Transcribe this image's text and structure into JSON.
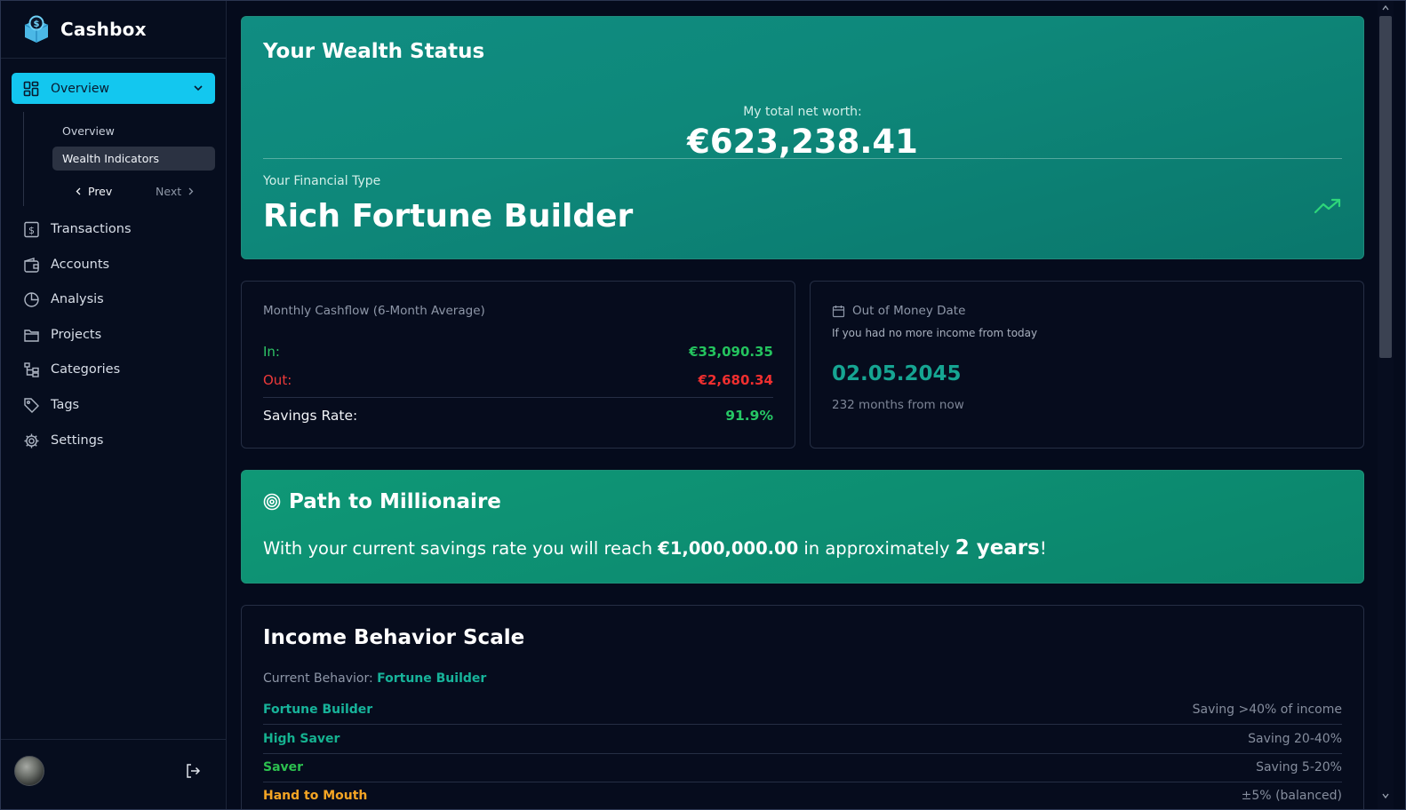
{
  "app": {
    "name": "Cashbox"
  },
  "sidebar": {
    "overview_label": "Overview",
    "sub_items": [
      {
        "label": "Overview"
      },
      {
        "label": "Wealth Indicators"
      }
    ],
    "prev_label": "Prev",
    "next_label": "Next",
    "items": [
      {
        "label": "Transactions",
        "icon": "dollar-receipt-icon"
      },
      {
        "label": "Accounts",
        "icon": "wallet-icon"
      },
      {
        "label": "Analysis",
        "icon": "pie-chart-icon"
      },
      {
        "label": "Projects",
        "icon": "folder-icon"
      },
      {
        "label": "Categories",
        "icon": "tree-icon"
      },
      {
        "label": "Tags",
        "icon": "tag-icon"
      },
      {
        "label": "Settings",
        "icon": "gear-icon"
      }
    ]
  },
  "hero": {
    "title": "Your Wealth Status",
    "net_worth_label": "My total net worth:",
    "net_worth_value": "€623,238.41",
    "type_label": "Your Financial Type",
    "type_value": "Rich Fortune Builder"
  },
  "cashflow": {
    "title": "Monthly Cashflow (6-Month Average)",
    "in_label": "In:",
    "in_value": "€33,090.35",
    "out_label": "Out:",
    "out_value": "€2,680.34",
    "rate_label": "Savings Rate:",
    "rate_value": "91.9%"
  },
  "out_of_money": {
    "title": "Out of Money Date",
    "subtitle": "If you had no more income from today",
    "date": "02.05.2045",
    "months": "232 months from now"
  },
  "path": {
    "title": "Path to Millionaire",
    "text_before": "With your current savings rate you will reach ",
    "amount": "€1,000,000.00",
    "text_mid": " in approximately ",
    "years": "2 years",
    "text_after": "!"
  },
  "scale": {
    "title": "Income Behavior Scale",
    "current_label": "Current Behavior: ",
    "current_value": "Fortune Builder",
    "rows": [
      {
        "name": "Fortune Builder",
        "desc": "Saving >40% of income",
        "color": "#17b39a"
      },
      {
        "name": "High Saver",
        "desc": "Saving 20-40%",
        "color": "#15b290"
      },
      {
        "name": "Saver",
        "desc": "Saving 5-20%",
        "color": "#2cc04f"
      },
      {
        "name": "Hand to Mouth",
        "desc": "±5% (balanced)",
        "color": "#f5a524"
      }
    ]
  },
  "colors": {
    "accent": "#13c7ef",
    "teal": "#17b39a",
    "positive": "#24c35e",
    "negative": "#f02f2f"
  }
}
